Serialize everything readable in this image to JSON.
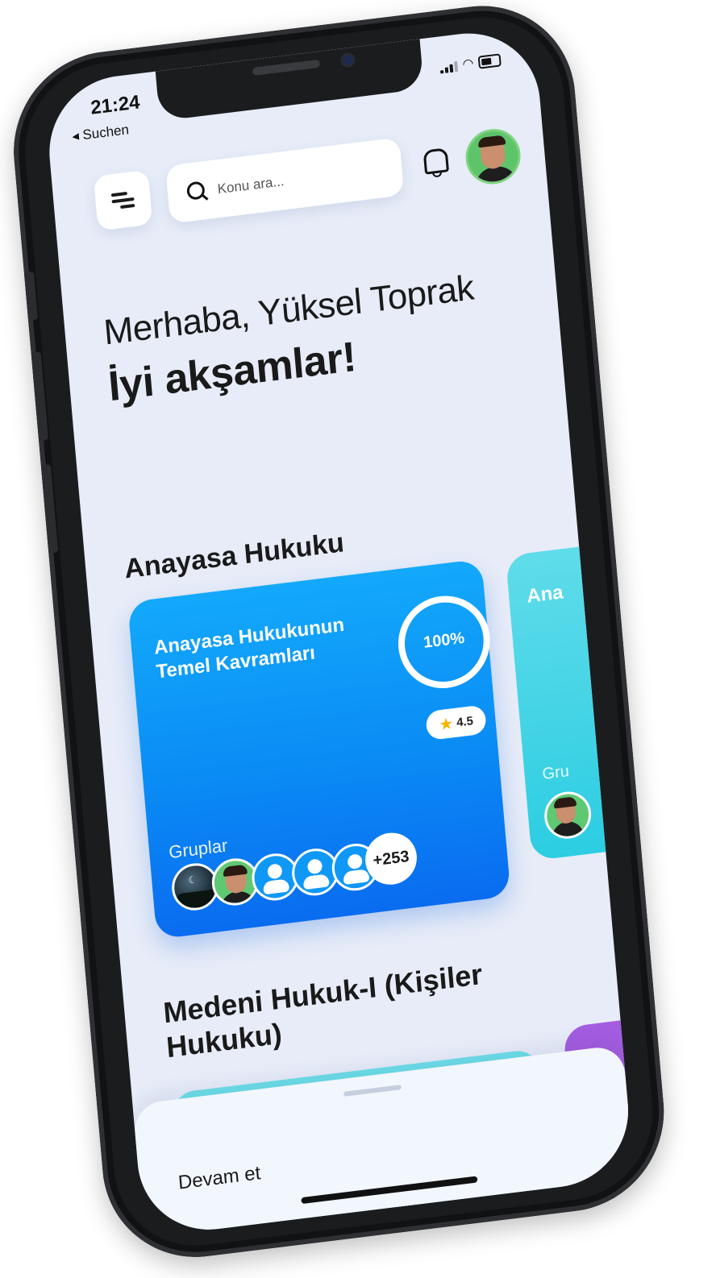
{
  "status_bar": {
    "time": "21:24",
    "back_label": "◂ Suchen"
  },
  "header": {
    "search_placeholder": "Konu ara..."
  },
  "greeting": {
    "hello": "Merhaba, Yüksel Toprak",
    "message": "İyi akşamlar!"
  },
  "sections": [
    {
      "title": "Anayasa Hukuku",
      "cards": [
        {
          "title": "Anayasa Hukukunun Temel Kavramları",
          "progress_text": "100%",
          "progress": 1.0,
          "rating": "4.5",
          "groups_label": "Gruplar",
          "groups_more": "+253",
          "color": "#0a8bf5"
        },
        {
          "title": "Ana",
          "groups_label": "Gru",
          "color": "#2ccde2"
        }
      ]
    },
    {
      "title": "Medeni Hukuk-I (Kişiler Hukuku)",
      "cards": [
        {
          "color": "#6ee0ea"
        },
        {
          "color": "#a45ce0"
        }
      ]
    }
  ],
  "bottom_sheet": {
    "label": "Devam et"
  },
  "icons": {
    "menu": "menu-icon",
    "search": "search-icon",
    "bell": "bell-icon",
    "star": "star-icon",
    "user": "user-icon"
  },
  "colors": {
    "background": "#e7ecf8",
    "accent": "#0a8bf5",
    "rating_star": "#f5b400"
  }
}
